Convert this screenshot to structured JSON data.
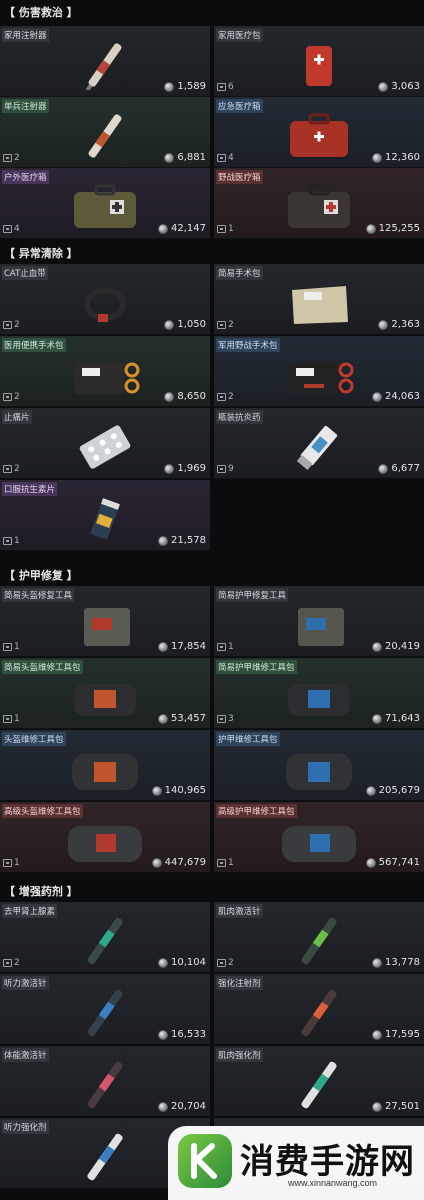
{
  "sections": {
    "healing": "【 伤害救治 】",
    "status": "【 异常清除 】",
    "armor": "【 护甲修复 】",
    "boost": "【 增强药剂 】"
  },
  "items": {
    "home_syringe": {
      "name": "家用注射器",
      "qty": "",
      "price": "1,589"
    },
    "home_medkit": {
      "name": "家用医疗包",
      "qty": "6",
      "price": "3,063"
    },
    "soldier_syringe": {
      "name": "单兵注射器",
      "qty": "2",
      "price": "6,881"
    },
    "emergency_kit": {
      "name": "应急医疗箱",
      "qty": "4",
      "price": "12,360"
    },
    "outdoor_kit": {
      "name": "户外医疗箱",
      "qty": "4",
      "price": "42,147"
    },
    "field_kit": {
      "name": "野战医疗箱",
      "qty": "1",
      "price": "125,255"
    },
    "cat_tourniquet": {
      "name": "CAT止血带",
      "qty": "2",
      "price": "1,050"
    },
    "simple_surgery": {
      "name": "简易手术包",
      "qty": "2",
      "price": "2,363"
    },
    "medical_surgery": {
      "name": "医用便携手术包",
      "qty": "2",
      "price": "8,650"
    },
    "military_surgery": {
      "name": "军用野战手术包",
      "qty": "2",
      "price": "24,063"
    },
    "painkiller": {
      "name": "止痛片",
      "qty": "2",
      "price": "1,969"
    },
    "bottle_anti": {
      "name": "瓶装抗炎药",
      "qty": "9",
      "price": "6,677"
    },
    "oral_antibiotic": {
      "name": "口服抗生素片",
      "qty": "1",
      "price": "21,578"
    },
    "helmet_tool_simple": {
      "name": "简易头盔修复工具",
      "qty": "1",
      "price": "17,854"
    },
    "armor_tool_simple": {
      "name": "简易护甲修复工具",
      "qty": "1",
      "price": "20,419"
    },
    "helmet_kit_simple": {
      "name": "简易头盔维修工具包",
      "qty": "1",
      "price": "53,457"
    },
    "armor_kit_simple": {
      "name": "简易护甲维修工具包",
      "qty": "3",
      "price": "71,643"
    },
    "helmet_kit": {
      "name": "头盔维修工具包",
      "qty": "",
      "price": "140,965"
    },
    "armor_kit": {
      "name": "护甲维修工具包",
      "qty": "",
      "price": "205,679"
    },
    "helmet_kit_adv": {
      "name": "高级头盔维修工具包",
      "qty": "1",
      "price": "447,679"
    },
    "armor_kit_adv": {
      "name": "高级护甲维修工具包",
      "qty": "1",
      "price": "567,741"
    },
    "epinephrine": {
      "name": "去甲肾上腺素",
      "qty": "2",
      "price": "10,104"
    },
    "muscle_inj": {
      "name": "肌肉激活针",
      "qty": "2",
      "price": "13,778"
    },
    "hearing_inj": {
      "name": "听力激活针",
      "qty": "",
      "price": "16,533"
    },
    "boost_syringe": {
      "name": "强化注射剂",
      "qty": "",
      "price": "17,595"
    },
    "stamina_inj": {
      "name": "体能激活针",
      "qty": "",
      "price": "20,704"
    },
    "muscle_boost": {
      "name": "肌肉强化剂",
      "qty": "",
      "price": "27,501"
    },
    "hearing_boost": {
      "name": "听力强化剂",
      "qty": "",
      "price": ""
    }
  },
  "watermark": {
    "title": "消费手游网",
    "url": "www.xinnanwang.com"
  }
}
